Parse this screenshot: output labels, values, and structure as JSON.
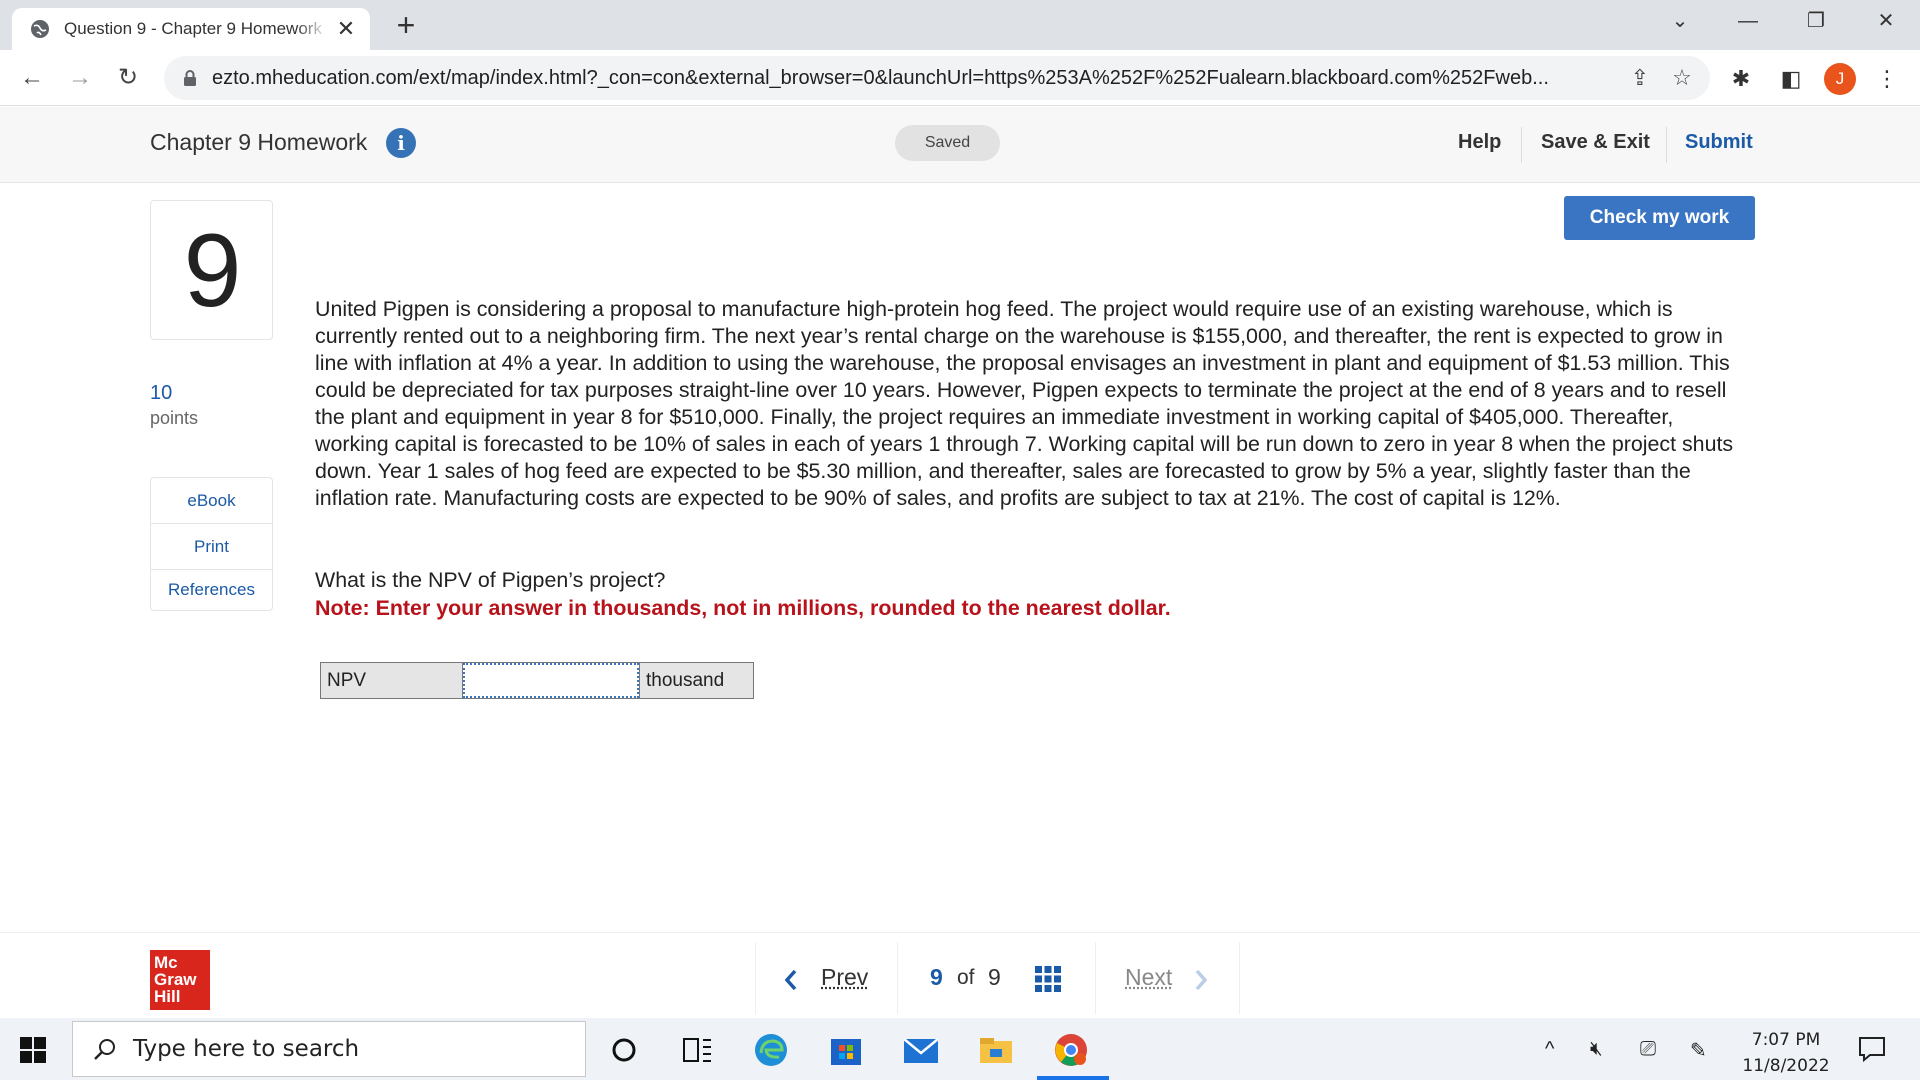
{
  "browser": {
    "tab_title": "Question 9 - Chapter 9 Homework",
    "url": "ezto.mheducation.com/ext/map/index.html?_con=con&external_browser=0&launchUrl=https%253A%252F%252Fualearn.blackboard.com%252Fweb...",
    "profile_initial": "J"
  },
  "header": {
    "title": "Chapter 9 Homework",
    "status": "Saved",
    "help_label": "Help",
    "save_exit_label": "Save & Exit",
    "submit_label": "Submit"
  },
  "question": {
    "number": "9",
    "points_value": "10",
    "points_label": "points",
    "check_label": "Check my work",
    "links": [
      "eBook",
      "Print",
      "References"
    ],
    "problem_text": "United Pigpen is considering a proposal to manufacture high-protein hog feed. The project would require use of an existing warehouse, which is currently rented out to a neighboring firm. The next year’s rental charge on the warehouse is $155,000, and thereafter, the rent is expected to grow in line with inflation at 4% a year. In addition to using the warehouse, the proposal envisages an investment in plant and equipment of $1.53 million. This could be depreciated for tax purposes straight-line over 10 years. However, Pigpen expects to terminate the project at the end of 8 years and to resell the plant and equipment in year 8 for $510,000. Finally, the project requires an immediate investment in working capital of $405,000. Thereafter, working capital is forecasted to be 10% of sales in each of years 1 through 7. Working capital will be run down to zero in year 8 when the project shuts down. Year 1 sales of hog feed are expected to be $5.30 million, and thereafter, sales are forecasted to grow by 5% a year, slightly faster than the inflation rate. Manufacturing costs are expected to be 90% of sales, and profits are subject to tax at 21%. The cost of capital is 12%.",
    "prompt": "What is the NPV of Pigpen’s project?",
    "note": "Note: Enter your answer in thousands, not in millions, rounded to the nearest dollar.",
    "answer": {
      "label": "NPV",
      "value": "",
      "unit": "thousand"
    }
  },
  "footer": {
    "brand_lines": [
      "Mc",
      "Graw",
      "Hill"
    ],
    "prev_label": "Prev",
    "current": "9",
    "of_label": "of",
    "total": "9",
    "next_label": "Next"
  },
  "taskbar": {
    "search_placeholder": "Type here to search",
    "time": "7:07 PM",
    "date": "11/8/2022"
  },
  "colors": {
    "accent_blue": "#3a75c4",
    "note_red": "#b8121a",
    "brand_red": "#d9261c",
    "link_blue": "#1a5aa6"
  }
}
